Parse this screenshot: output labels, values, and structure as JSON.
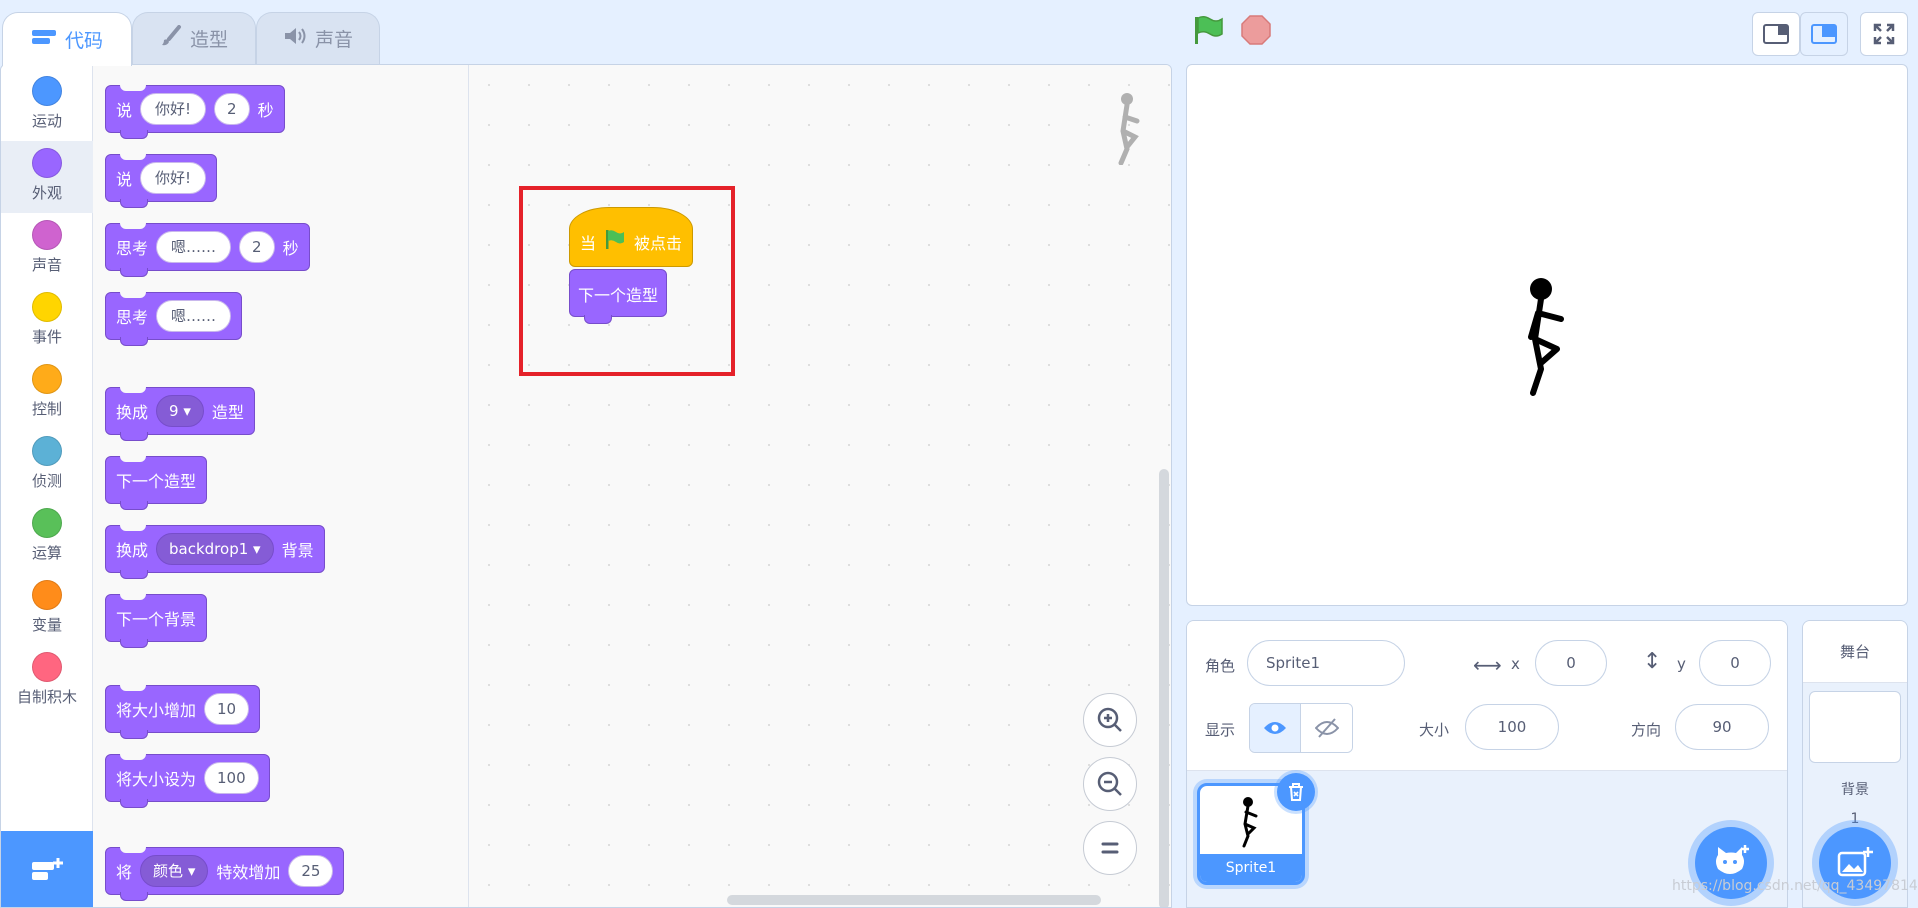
{
  "tabs": [
    {
      "label": "代码",
      "icon": "code-icon"
    },
    {
      "label": "造型",
      "icon": "brush-icon"
    },
    {
      "label": "声音",
      "icon": "speaker-icon"
    }
  ],
  "categories": [
    {
      "label": "运动",
      "color": "#4c97ff"
    },
    {
      "label": "外观",
      "color": "#9966ff"
    },
    {
      "label": "声音",
      "color": "#cf63cf"
    },
    {
      "label": "事件",
      "color": "#ffd500"
    },
    {
      "label": "控制",
      "color": "#ffab19"
    },
    {
      "label": "侦测",
      "color": "#5cb1d6"
    },
    {
      "label": "运算",
      "color": "#59c059"
    },
    {
      "label": "变量",
      "color": "#ff8c1a"
    },
    {
      "label": "自制积木",
      "color": "#ff6680"
    }
  ],
  "palette": {
    "say_secs": {
      "a": "说",
      "msg": "你好!",
      "secs": "2",
      "b": "秒"
    },
    "say": {
      "a": "说",
      "msg": "你好!"
    },
    "think_secs": {
      "a": "思考",
      "msg": "嗯……",
      "secs": "2",
      "b": "秒"
    },
    "think": {
      "a": "思考",
      "msg": "嗯……"
    },
    "switch_costume": {
      "a": "换成",
      "val": "9",
      "b": "造型"
    },
    "next_costume": "下一个造型",
    "switch_backdrop": {
      "a": "换成",
      "val": "backdrop1",
      "b": "背景"
    },
    "next_backdrop": "下一个背景",
    "change_size": {
      "a": "将大小增加",
      "val": "10"
    },
    "set_size": {
      "a": "将大小设为",
      "val": "100"
    },
    "change_effect": {
      "a": "将",
      "effect": "颜色",
      "b": "特效增加",
      "val": "25"
    }
  },
  "script": {
    "hat_a": "当",
    "hat_b": "被点击",
    "next": "下一个造型"
  },
  "zoom": {
    "in": "+",
    "out": "−",
    "reset": "="
  },
  "sprite_info": {
    "sprite_label": "角色",
    "sprite_name": "Sprite1",
    "x_label": "x",
    "x": "0",
    "y_label": "y",
    "y": "0",
    "show_label": "显示",
    "size_label": "大小",
    "size": "100",
    "dir_label": "方向",
    "direction": "90"
  },
  "sprites": [
    {
      "name": "Sprite1"
    }
  ],
  "stage_pane": {
    "title": "舞台",
    "backdrops_label": "背景",
    "backdrop_count": "1"
  },
  "watermark": "https://blog.csdn.net/qq_43497814"
}
